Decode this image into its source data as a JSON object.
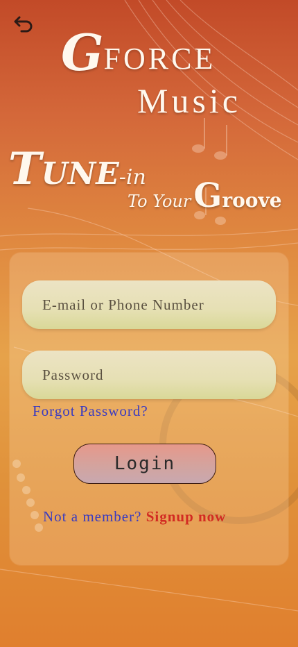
{
  "header": {
    "back_icon": "undo-arrow-icon",
    "brand_first_letter": "G",
    "brand_force": "FORCE",
    "brand_music": "Music",
    "tagline_t": "T",
    "tagline_une": "UNE",
    "tagline_in": "-in",
    "tagline_to_your": "To Your",
    "tagline_g": "G",
    "tagline_roove": "roove"
  },
  "form": {
    "email_placeholder": "E-mail or Phone Number",
    "email_value": "",
    "password_placeholder": "Password",
    "password_value": "",
    "forgot_label": "Forgot Password?",
    "login_label": "Login",
    "signup_question": "Not a member?",
    "signup_link": "Signup now"
  },
  "colors": {
    "link_blue": "#3a3bc0",
    "signup_red": "#d22a22",
    "text_cream": "#fff8ee"
  }
}
